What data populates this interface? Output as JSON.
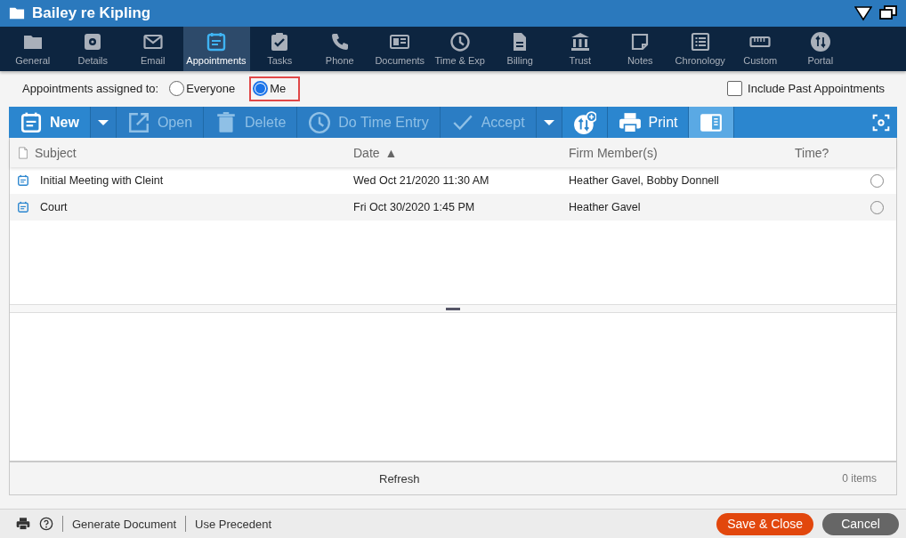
{
  "window": {
    "title": "Bailey re Kipling"
  },
  "tabs": [
    {
      "label": "General",
      "selected": false
    },
    {
      "label": "Details",
      "selected": false
    },
    {
      "label": "Email",
      "selected": false
    },
    {
      "label": "Appointments",
      "selected": true
    },
    {
      "label": "Tasks",
      "selected": false
    },
    {
      "label": "Phone",
      "selected": false
    },
    {
      "label": "Documents",
      "selected": false
    },
    {
      "label": "Time & Exp",
      "selected": false
    },
    {
      "label": "Billing",
      "selected": false
    },
    {
      "label": "Trust",
      "selected": false
    },
    {
      "label": "Notes",
      "selected": false
    },
    {
      "label": "Chronology",
      "selected": false
    },
    {
      "label": "Custom",
      "selected": false
    },
    {
      "label": "Portal",
      "selected": false
    }
  ],
  "filter": {
    "label": "Appointments assigned to:",
    "options": [
      {
        "label": "Everyone",
        "selected": false,
        "highlighted": false
      },
      {
        "label": "Me",
        "selected": true,
        "highlighted": true
      }
    ],
    "include_past": {
      "label": "Include Past Appointments",
      "checked": false
    }
  },
  "toolbar": [
    {
      "kind": "new",
      "label": "New",
      "disabled": false
    },
    {
      "kind": "dropdown",
      "disabled": false
    },
    {
      "kind": "open",
      "label": "Open",
      "disabled": true
    },
    {
      "kind": "delete",
      "label": "Delete",
      "disabled": true
    },
    {
      "kind": "time",
      "label": "Do Time Entry",
      "disabled": true
    },
    {
      "kind": "accept",
      "label": "Accept",
      "disabled": true
    },
    {
      "kind": "dropdown",
      "disabled": false
    },
    {
      "kind": "sync",
      "disabled": false
    },
    {
      "kind": "print",
      "label": "Print",
      "disabled": false
    },
    {
      "kind": "preview",
      "disabled": false,
      "selected": true
    }
  ],
  "table": {
    "columns": [
      {
        "label": "Subject"
      },
      {
        "label": "Date",
        "sort_indicator": "▲"
      },
      {
        "label": "Firm Member(s)"
      },
      {
        "label": "Time?"
      }
    ],
    "rows": [
      {
        "subject": "Initial Meeting with Cleint",
        "date": "Wed Oct 21/2020 11:30 AM",
        "members": "Heather Gavel, Bobby Donnell",
        "time": false
      },
      {
        "subject": "Court",
        "date": "Fri Oct 30/2020 1:45 PM",
        "members": "Heather Gavel",
        "time": false
      }
    ]
  },
  "status": {
    "refresh": "Refresh",
    "count": "0 items"
  },
  "footer": {
    "links": [
      "Generate Document",
      "Use Precedent"
    ],
    "buttons": [
      {
        "kind": "primary",
        "label": "Save & Close"
      },
      {
        "kind": "secondary",
        "label": "Cancel"
      }
    ]
  }
}
